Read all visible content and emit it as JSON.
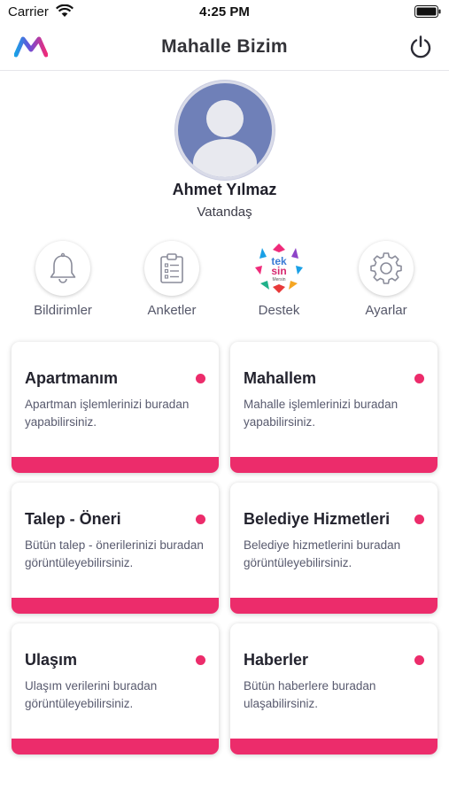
{
  "status_bar": {
    "carrier": "Carrier",
    "time": "4:25 PM"
  },
  "header": {
    "title": "Mahalle Bizim"
  },
  "profile": {
    "name": "Ahmet Yılmaz",
    "role": "Vatandaş"
  },
  "quick_actions": [
    {
      "label": "Bildirimler",
      "icon": "bell-icon"
    },
    {
      "label": "Anketler",
      "icon": "clipboard-icon"
    },
    {
      "label": "Destek",
      "icon": "teksin-mersin-logo",
      "logo_text": [
        "tek",
        "sin",
        "Mersin"
      ]
    },
    {
      "label": "Ayarlar",
      "icon": "gear-icon"
    }
  ],
  "cards": [
    {
      "title": "Apartmanım",
      "description": "Apartman işlemlerinizi buradan yapabilirsiniz."
    },
    {
      "title": "Mahallem",
      "description": "Mahalle işlemlerinizi buradan yapabilirsiniz."
    },
    {
      "title": "Talep - Öneri",
      "description": "Bütün talep - önerilerinizi buradan görüntüleyebilirsiniz."
    },
    {
      "title": "Belediye Hizmetleri",
      "description": "Belediye hizmetlerini buradan görüntüleyebilirsiniz."
    },
    {
      "title": "Ulaşım",
      "description": "Ulaşım verilerini buradan görüntüleyebilirsiniz."
    },
    {
      "title": "Haberler",
      "description": "Bütün haberlere buradan ulaşabilirsiniz."
    }
  ],
  "colors": {
    "accent": "#ec2c6b",
    "avatar_bg": "#6f80b8"
  }
}
